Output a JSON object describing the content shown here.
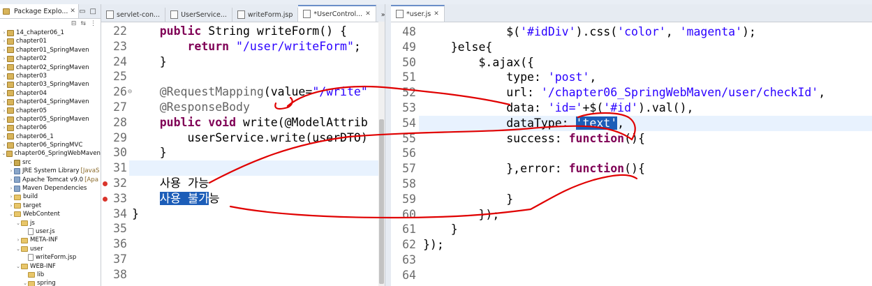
{
  "explorer": {
    "title": "Package Explo...",
    "close": "✕",
    "items": [
      {
        "label": "14_chapter06_1",
        "type": "proj",
        "depth": 0,
        "twisty": "›"
      },
      {
        "label": "chapter01",
        "type": "proj",
        "depth": 0,
        "twisty": "›"
      },
      {
        "label": "chapter01_SpringMaven",
        "type": "proj",
        "depth": 0,
        "twisty": "›"
      },
      {
        "label": "chapter02",
        "type": "proj",
        "depth": 0,
        "twisty": "›"
      },
      {
        "label": "chapter02_SpringMaven",
        "type": "proj",
        "depth": 0,
        "twisty": "›"
      },
      {
        "label": "chapter03",
        "type": "proj",
        "depth": 0,
        "twisty": "›"
      },
      {
        "label": "chapter03_SpringMaven",
        "type": "proj",
        "depth": 0,
        "twisty": "›"
      },
      {
        "label": "chapter04",
        "type": "proj",
        "depth": 0,
        "twisty": "›"
      },
      {
        "label": "chapter04_SpringMaven",
        "type": "proj",
        "depth": 0,
        "twisty": "›"
      },
      {
        "label": "chapter05",
        "type": "proj",
        "depth": 0,
        "twisty": "›"
      },
      {
        "label": "chapter05_SpringMaven",
        "type": "proj",
        "depth": 0,
        "twisty": "›"
      },
      {
        "label": "chapter06",
        "type": "proj",
        "depth": 0,
        "twisty": "›"
      },
      {
        "label": "chapter06_1",
        "type": "proj",
        "depth": 0,
        "twisty": "›"
      },
      {
        "label": "chapter06_SpringMVC",
        "type": "proj",
        "depth": 0,
        "twisty": "›"
      },
      {
        "label": "chapter06_SpringWebMaven",
        "type": "proj",
        "depth": 0,
        "twisty": "⌄"
      },
      {
        "label": "src",
        "type": "src",
        "depth": 1,
        "twisty": "›"
      },
      {
        "label": "JRE System Library",
        "suffix": "[JavaS",
        "type": "lib",
        "depth": 1,
        "twisty": "›"
      },
      {
        "label": "Apache Tomcat v9.0",
        "suffix": "[Apa",
        "type": "lib",
        "depth": 1,
        "twisty": "›"
      },
      {
        "label": "Maven Dependencies",
        "type": "lib",
        "depth": 1,
        "twisty": "›"
      },
      {
        "label": "build",
        "type": "folder",
        "depth": 1,
        "twisty": "›"
      },
      {
        "label": "target",
        "type": "folder",
        "depth": 1,
        "twisty": "›"
      },
      {
        "label": "WebContent",
        "type": "folder",
        "depth": 1,
        "twisty": "⌄"
      },
      {
        "label": "js",
        "type": "folder",
        "depth": 2,
        "twisty": "⌄"
      },
      {
        "label": "user.js",
        "type": "file",
        "depth": 3,
        "twisty": ""
      },
      {
        "label": "META-INF",
        "type": "folder",
        "depth": 2,
        "twisty": "›"
      },
      {
        "label": "user",
        "type": "folder",
        "depth": 2,
        "twisty": "⌄"
      },
      {
        "label": "writeForm.jsp",
        "type": "file",
        "depth": 3,
        "twisty": ""
      },
      {
        "label": "WEB-INF",
        "type": "folder",
        "depth": 2,
        "twisty": "⌄"
      },
      {
        "label": "lib",
        "type": "folder",
        "depth": 3,
        "twisty": ""
      },
      {
        "label": "spring",
        "type": "folder",
        "depth": 3,
        "twisty": "⌄"
      }
    ]
  },
  "editor1": {
    "tabs": [
      {
        "label": "servlet-con...",
        "active": false
      },
      {
        "label": "UserService...",
        "active": false
      },
      {
        "label": "writeForm.jsp",
        "active": false
      },
      {
        "label": "*UserControl...",
        "active": true
      },
      {
        "label": "»",
        "active": false
      }
    ],
    "close": "✕",
    "lines": [
      {
        "n": "22",
        "parts": [
          {
            "t": "    "
          },
          {
            "t": "public",
            "c": "kw"
          },
          {
            "t": " String writeForm() {"
          }
        ]
      },
      {
        "n": "23",
        "parts": [
          {
            "t": "        "
          },
          {
            "t": "return",
            "c": "kw"
          },
          {
            "t": " "
          },
          {
            "t": "\"/user/writeForm\"",
            "c": "str"
          },
          {
            "t": ";"
          }
        ]
      },
      {
        "n": "24",
        "parts": [
          {
            "t": "    }"
          }
        ]
      },
      {
        "n": "25",
        "parts": []
      },
      {
        "n": "26",
        "mark": "⊖",
        "parts": [
          {
            "t": "    "
          },
          {
            "t": "@RequestMapping",
            "c": "ann"
          },
          {
            "t": "(value="
          },
          {
            "t": "\"/write\"",
            "c": "str"
          }
        ]
      },
      {
        "n": "27",
        "parts": [
          {
            "t": "    "
          },
          {
            "t": "@ResponseBody",
            "c": "ann"
          }
        ]
      },
      {
        "n": "28",
        "parts": [
          {
            "t": "    "
          },
          {
            "t": "public",
            "c": "kw"
          },
          {
            "t": " "
          },
          {
            "t": "void",
            "c": "kw"
          },
          {
            "t": " write(@ModelAttrib"
          }
        ]
      },
      {
        "n": "29",
        "parts": [
          {
            "t": "        userService.write(userDTO)"
          }
        ]
      },
      {
        "n": "30",
        "parts": [
          {
            "t": "    }"
          }
        ]
      },
      {
        "n": "31",
        "parts": [],
        "current": true
      },
      {
        "n": "32",
        "err": true,
        "parts": [
          {
            "t": "    사용 가능"
          }
        ]
      },
      {
        "n": "33",
        "err": true,
        "parts": [
          {
            "t": "    "
          },
          {
            "t": "사용 불가",
            "c": "sel"
          },
          {
            "t": "능"
          }
        ]
      },
      {
        "n": "34",
        "parts": [
          {
            "t": "}"
          }
        ]
      },
      {
        "n": "35",
        "parts": []
      },
      {
        "n": "36",
        "parts": []
      },
      {
        "n": "37",
        "parts": []
      },
      {
        "n": "38",
        "parts": []
      }
    ]
  },
  "editor2": {
    "tabs": [
      {
        "label": "*user.js",
        "active": true
      }
    ],
    "close": "✕",
    "lines": [
      {
        "n": "48",
        "parts": [
          {
            "t": "            $("
          },
          {
            "t": "'#idDiv'",
            "c": "jsstr"
          },
          {
            "t": ").css("
          },
          {
            "t": "'color'",
            "c": "jsstr"
          },
          {
            "t": ", "
          },
          {
            "t": "'magenta'",
            "c": "jsstr"
          },
          {
            "t": ");"
          }
        ]
      },
      {
        "n": "49",
        "parts": [
          {
            "t": "    }else{"
          }
        ]
      },
      {
        "n": "50",
        "parts": [
          {
            "t": "        $.ajax({"
          }
        ]
      },
      {
        "n": "51",
        "parts": [
          {
            "t": "            type: "
          },
          {
            "t": "'post'",
            "c": "jsstr"
          },
          {
            "t": ","
          }
        ]
      },
      {
        "n": "52",
        "parts": [
          {
            "t": "            url: "
          },
          {
            "t": "'/chapter06_SpringWebMaven/user/checkId'",
            "c": "jsstr"
          },
          {
            "t": ","
          }
        ]
      },
      {
        "n": "53",
        "parts": [
          {
            "t": "            data: "
          },
          {
            "t": "'id='",
            "c": "jsstr"
          },
          {
            "t": "+$("
          },
          {
            "t": "'#id'",
            "c": "jsstr"
          },
          {
            "t": ").val(),"
          }
        ]
      },
      {
        "n": "54",
        "current": true,
        "parts": [
          {
            "t": "            dataType: "
          },
          {
            "t": "'text'",
            "c": "sel"
          },
          {
            "t": ","
          }
        ]
      },
      {
        "n": "55",
        "parts": [
          {
            "t": "            success: "
          },
          {
            "t": "function",
            "c": "kw"
          },
          {
            "t": "(){"
          }
        ]
      },
      {
        "n": "56",
        "parts": []
      },
      {
        "n": "57",
        "parts": [
          {
            "t": "            },error: "
          },
          {
            "t": "function",
            "c": "kw"
          },
          {
            "t": "(){"
          }
        ]
      },
      {
        "n": "58",
        "parts": []
      },
      {
        "n": "59",
        "parts": [
          {
            "t": "            }"
          }
        ]
      },
      {
        "n": "60",
        "parts": [
          {
            "t": "        });"
          }
        ]
      },
      {
        "n": "61",
        "parts": [
          {
            "t": "    }"
          }
        ]
      },
      {
        "n": "62",
        "parts": [
          {
            "t": "});"
          }
        ]
      },
      {
        "n": "63",
        "parts": []
      },
      {
        "n": "64",
        "parts": []
      }
    ]
  },
  "annotation_color": "#e00000"
}
